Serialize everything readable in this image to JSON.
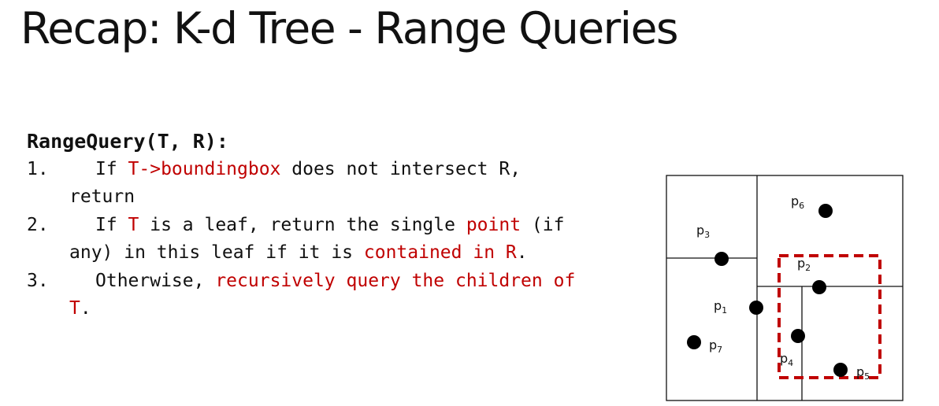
{
  "title": "Recap: K-d Tree - Range Queries",
  "algorithm": {
    "heading": "RangeQuery(T, R):",
    "steps": [
      {
        "number": "1.",
        "segments": [
          {
            "text": "If ",
            "highlight": false
          },
          {
            "text": "T->boundingbox",
            "highlight": true
          },
          {
            "text": " does not intersect R, return",
            "highlight": false
          }
        ]
      },
      {
        "number": "2.",
        "segments": [
          {
            "text": "If ",
            "highlight": false
          },
          {
            "text": "T",
            "highlight": true
          },
          {
            "text": " is a leaf, return the single ",
            "highlight": false
          },
          {
            "text": "point",
            "highlight": true
          },
          {
            "text": " (if any) in this leaf if it is ",
            "highlight": false
          },
          {
            "text": "contained in R",
            "highlight": true
          },
          {
            "text": ".",
            "highlight": false
          }
        ]
      },
      {
        "number": "3.",
        "segments": [
          {
            "text": "Otherwise, ",
            "highlight": false
          },
          {
            "text": "recursively query the children of T",
            "highlight": true
          },
          {
            "text": ".",
            "highlight": false
          }
        ]
      }
    ]
  },
  "diagram": {
    "points": [
      {
        "name": "p",
        "sub": "1"
      },
      {
        "name": "p",
        "sub": "2"
      },
      {
        "name": "p",
        "sub": "3"
      },
      {
        "name": "p",
        "sub": "4"
      },
      {
        "name": "p",
        "sub": "5"
      },
      {
        "name": "p",
        "sub": "6"
      },
      {
        "name": "p",
        "sub": "7"
      }
    ],
    "colors": {
      "line": "#111111",
      "point": "#000000",
      "query_range": "#c00000",
      "highlight_text": "#c00000"
    }
  }
}
